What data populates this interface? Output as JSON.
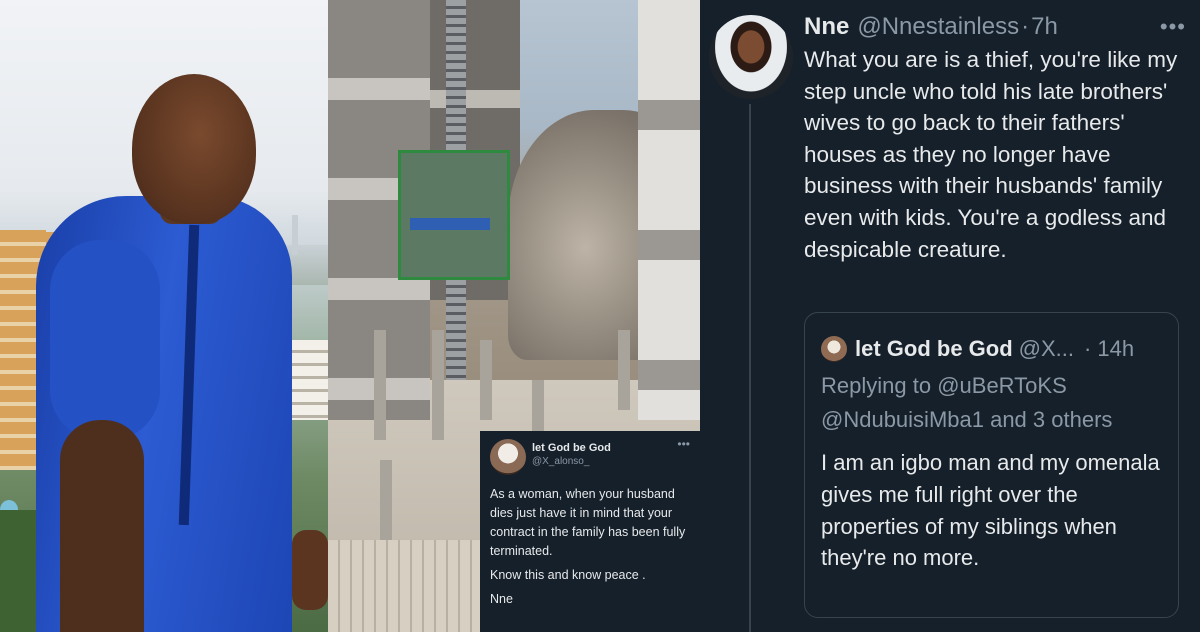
{
  "main_tweet": {
    "name": "Nne",
    "handle": "@Nnestainless",
    "time": "7h",
    "more": "•••",
    "text": "What you are is a thief, you're like my step uncle who told his late brothers' wives to go back to their fathers' houses as they no longer have business with their husbands' family even with kids. You're a godless and despicable creature."
  },
  "quoted_tweet": {
    "name": "let God be God",
    "handle": "@X...",
    "time": "14h",
    "replying_prefix": "Replying to",
    "replying_to": "@uBeRToKS @NdubuisiMba1 and 3 others",
    "text": "I am an igbo man and my omenala gives me full right over the properties of my siblings when they're no more."
  },
  "inset_tweet": {
    "name": "let God be God",
    "handle": "@X_alonso_",
    "more": "•••",
    "text_1": "As a woman, when your husband dies just have it in mind that your contract in the family has been fully terminated.",
    "text_2": "Know this and know peace .",
    "text_3": "Nne"
  },
  "colors": {
    "tweet_background": "#15202b",
    "primary_text": "#e7e9ea",
    "secondary_text": "#8b98a5",
    "border": "#38444d"
  }
}
